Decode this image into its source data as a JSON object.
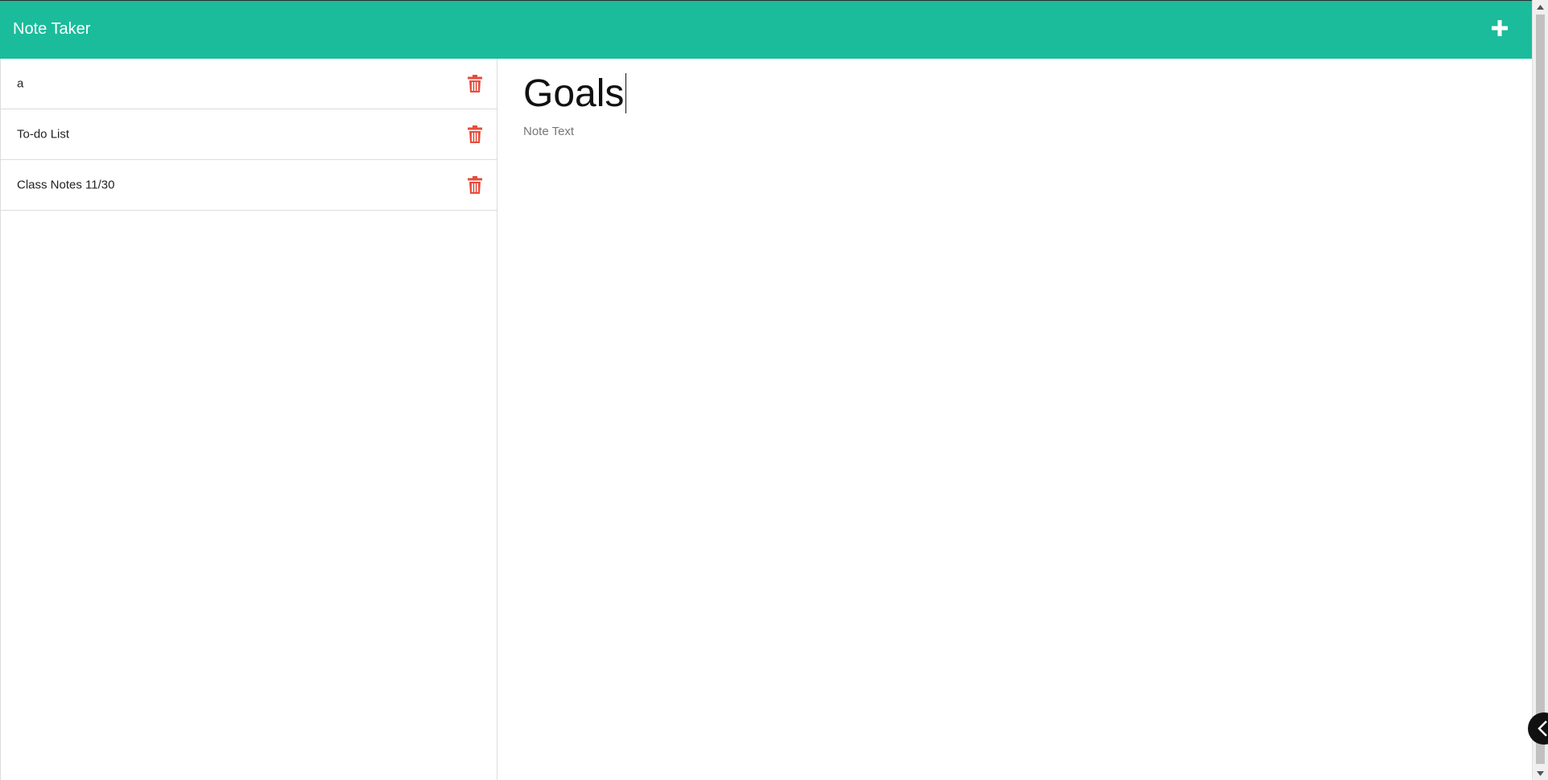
{
  "header": {
    "title": "Note Taker",
    "new_note_icon": "plus-icon",
    "background_color": "#1abc9c"
  },
  "sidebar": {
    "items": [
      {
        "label": "a",
        "delete_icon": "trash-icon"
      },
      {
        "label": "To-do List",
        "delete_icon": "trash-icon"
      },
      {
        "label": "Class Notes 11/30",
        "delete_icon": "trash-icon"
      }
    ],
    "delete_color": "#e74c3c"
  },
  "editor": {
    "title_value": "Goals",
    "text_placeholder": "Note Text",
    "text_value": ""
  }
}
